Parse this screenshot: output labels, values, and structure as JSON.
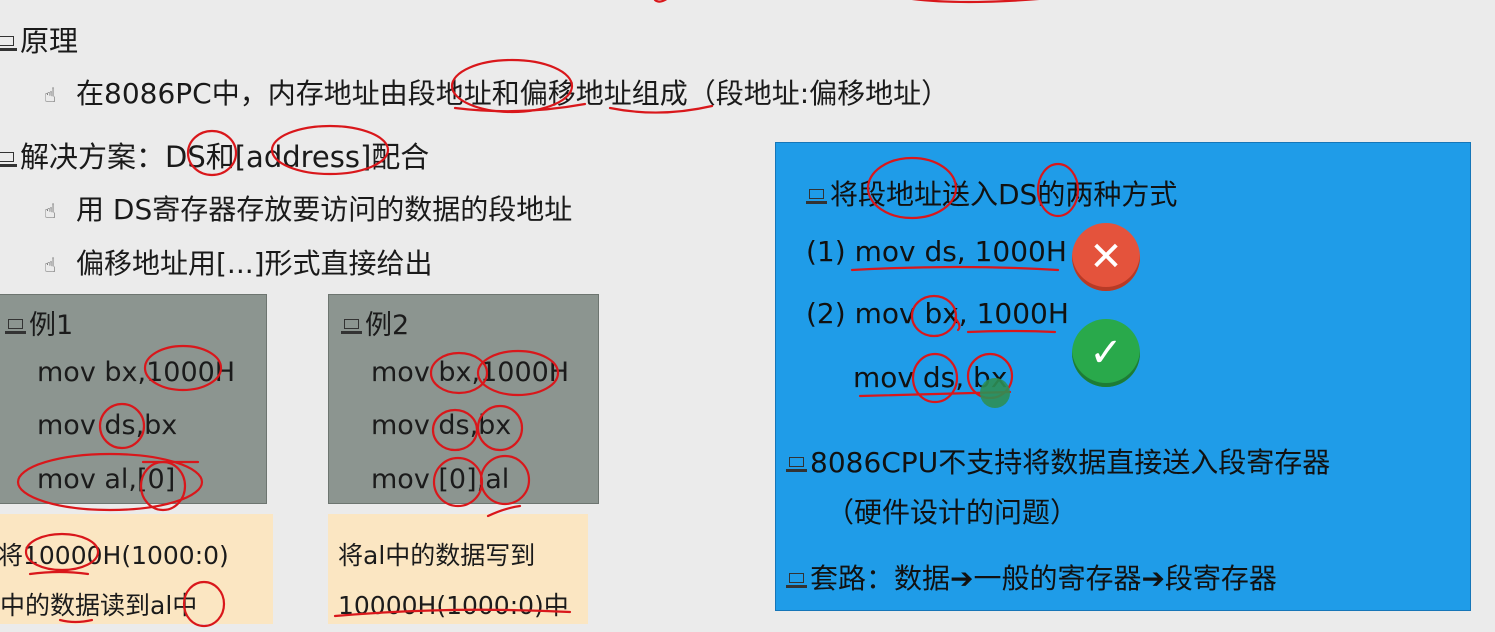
{
  "section1": {
    "title": "原理",
    "point": "在8086PC中，内存地址由段地址和偏移地址组成（段地址:偏移地址）"
  },
  "section2": {
    "title": "解决方案：DS和[address]配合",
    "points": [
      "用 DS寄存器存放要访问的数据的段地址",
      "偏移地址用[...]形式直接给出"
    ]
  },
  "example1": {
    "title": "例1",
    "lines": [
      "mov bx,1000H",
      "mov ds,bx",
      "mov al,[0]"
    ],
    "note": [
      "将10000H(1000:0)",
      "中的数据读到al中"
    ]
  },
  "example2": {
    "title": "例2",
    "lines": [
      "mov bx,1000H",
      "mov ds,bx",
      "mov [0],al"
    ],
    "note": [
      "将al中的数据写到",
      "10000H(1000:0)中"
    ]
  },
  "panel": {
    "title": "将段地址送入DS的两种方式",
    "way1": "(1) mov ds, 1000H",
    "way2_a": "(2) mov bx, 1000H",
    "way2_b": "mov ds, bx",
    "wrong_mark": "✕",
    "right_mark": "✓",
    "point1_a": "8086CPU不支持将数据直接送入段寄存器",
    "point1_b": "（硬件设计的问题）",
    "point2": "套路：数据➔一般的寄存器➔段寄存器"
  },
  "colors": {
    "panel_bg": "#1f9ce8",
    "example_bg": "#8c9590",
    "note_bg": "#fbe6c2",
    "ink": "#d9171b"
  },
  "icons": [
    "computer-icon",
    "hand-pointer-icon",
    "cross-badge-icon",
    "check-badge-icon"
  ]
}
